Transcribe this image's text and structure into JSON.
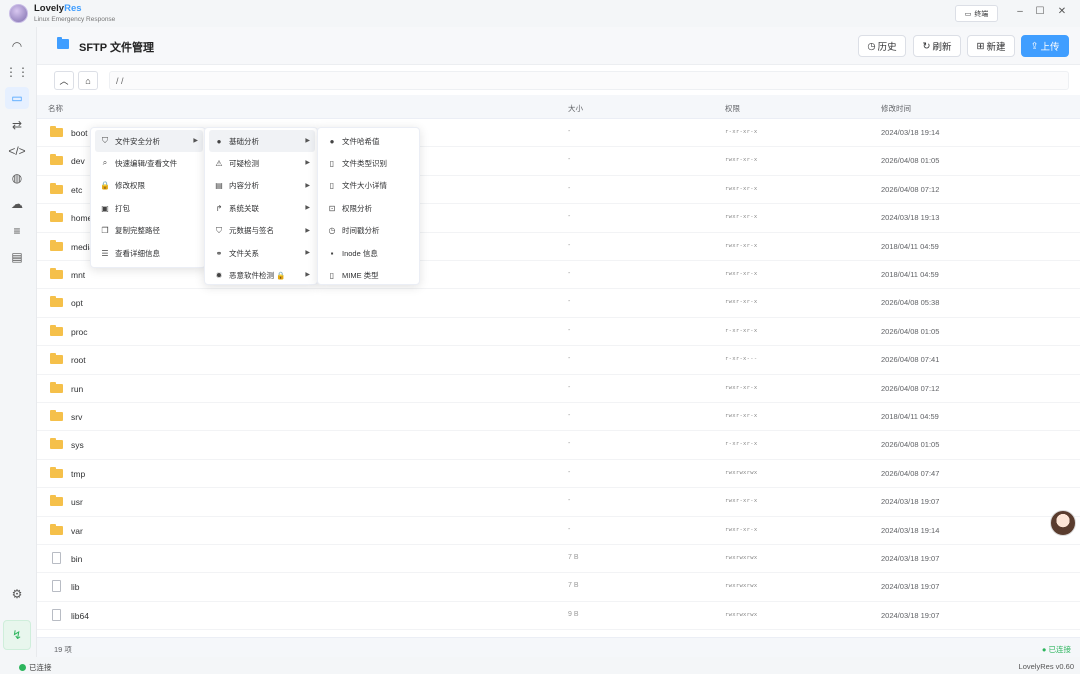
{
  "app": {
    "name_part1": "Lovely",
    "name_part2": "Res",
    "subtitle": "Linux Emergency Response",
    "terminal_label": "终端",
    "version": "LovelyRes v0.60",
    "status_connected": "已连接"
  },
  "header": {
    "title": "SFTP 文件管理",
    "history_label": "历史",
    "refresh_label": "刷新",
    "new_label": "新建",
    "upload_label": "上传"
  },
  "path": {
    "value": "/ /"
  },
  "columns": {
    "name": "名称",
    "size": "大小",
    "permission": "权限",
    "mtime": "修改时间"
  },
  "files": [
    {
      "name": "boot",
      "type": "dir",
      "size": "-",
      "perm": "r-xr-xr-x",
      "mtime": "2024/03/18 19:14"
    },
    {
      "name": "dev",
      "type": "dir",
      "size": "-",
      "perm": "rwxr-xr-x",
      "mtime": "2026/04/08 01:05"
    },
    {
      "name": "etc",
      "type": "dir",
      "size": "-",
      "perm": "rwxr-xr-x",
      "mtime": "2026/04/08 07:12"
    },
    {
      "name": "home",
      "type": "dir",
      "size": "-",
      "perm": "rwxr-xr-x",
      "mtime": "2024/03/18 19:13"
    },
    {
      "name": "media",
      "type": "dir",
      "size": "-",
      "perm": "rwxr-xr-x",
      "mtime": "2018/04/11 04:59"
    },
    {
      "name": "mnt",
      "type": "dir",
      "size": "-",
      "perm": "rwxr-xr-x",
      "mtime": "2018/04/11 04:59"
    },
    {
      "name": "opt",
      "type": "dir",
      "size": "-",
      "perm": "rwxr-xr-x",
      "mtime": "2026/04/08 05:38"
    },
    {
      "name": "proc",
      "type": "dir",
      "size": "-",
      "perm": "r-xr-xr-x",
      "mtime": "2026/04/08 01:05"
    },
    {
      "name": "root",
      "type": "dir",
      "size": "-",
      "perm": "r-xr-x---",
      "mtime": "2026/04/08 07:41"
    },
    {
      "name": "run",
      "type": "dir",
      "size": "-",
      "perm": "rwxr-xr-x",
      "mtime": "2026/04/08 07:12"
    },
    {
      "name": "srv",
      "type": "dir",
      "size": "-",
      "perm": "rwxr-xr-x",
      "mtime": "2018/04/11 04:59"
    },
    {
      "name": "sys",
      "type": "dir",
      "size": "-",
      "perm": "r-xr-xr-x",
      "mtime": "2026/04/08 01:05"
    },
    {
      "name": "tmp",
      "type": "dir",
      "size": "-",
      "perm": "rwxrwxrwx",
      "mtime": "2026/04/08 07:47"
    },
    {
      "name": "usr",
      "type": "dir",
      "size": "-",
      "perm": "rwxr-xr-x",
      "mtime": "2024/03/18 19:07"
    },
    {
      "name": "var",
      "type": "dir",
      "size": "-",
      "perm": "rwxr-xr-x",
      "mtime": "2024/03/18 19:14"
    },
    {
      "name": "bin",
      "type": "file",
      "size": "7 B",
      "perm": "rwxrwxrwx",
      "mtime": "2024/03/18 19:07"
    },
    {
      "name": "lib",
      "type": "file",
      "size": "7 B",
      "perm": "rwxrwxrwx",
      "mtime": "2024/03/18 19:07"
    },
    {
      "name": "lib64",
      "type": "file",
      "size": "9 B",
      "perm": "rwxrwxrwx",
      "mtime": "2024/03/18 19:07"
    }
  ],
  "footer": {
    "count": "19 项",
    "connected": "● 已连接"
  },
  "context_menu": {
    "main": [
      {
        "label": "文件安全分析",
        "icon": "shield-icon",
        "sub": true
      },
      {
        "label": "快速编辑/查看文件",
        "icon": "search-icon"
      },
      {
        "label": "修改权限",
        "icon": "lock-icon"
      },
      {
        "label": "打包",
        "icon": "archive-icon"
      },
      {
        "label": "复制完整路径",
        "icon": "copy-icon"
      },
      {
        "label": "查看详细信息",
        "icon": "details-icon"
      }
    ],
    "security": [
      {
        "label": "基础分析",
        "icon": "basic-analysis-icon",
        "sub": true
      },
      {
        "label": "可疑检测",
        "icon": "suspicious-icon",
        "sub": true
      },
      {
        "label": "内容分析",
        "icon": "content-icon",
        "sub": true
      },
      {
        "label": "系统关联",
        "icon": "link-icon",
        "sub": true
      },
      {
        "label": "元数据与签名",
        "icon": "shield-icon",
        "sub": true
      },
      {
        "label": "文件关系",
        "icon": "relation-icon",
        "sub": true
      },
      {
        "label": "恶意软件检测 🔒",
        "icon": "bug-icon",
        "sub": true
      }
    ],
    "basic": [
      {
        "label": "文件哈希值",
        "icon": "hash-icon"
      },
      {
        "label": "文件类型识别",
        "icon": "file-type-icon"
      },
      {
        "label": "文件大小详情",
        "icon": "file-size-icon"
      },
      {
        "label": "权限分析",
        "icon": "permission-icon"
      },
      {
        "label": "时间戳分析",
        "icon": "clock-icon"
      },
      {
        "label": "Inode 信息",
        "icon": "inode-icon"
      },
      {
        "label": "MIME 类型",
        "icon": "mime-icon"
      }
    ]
  },
  "colors": {
    "accent": "#409eff",
    "success": "#2db55d",
    "folder": "#f5c04a"
  }
}
